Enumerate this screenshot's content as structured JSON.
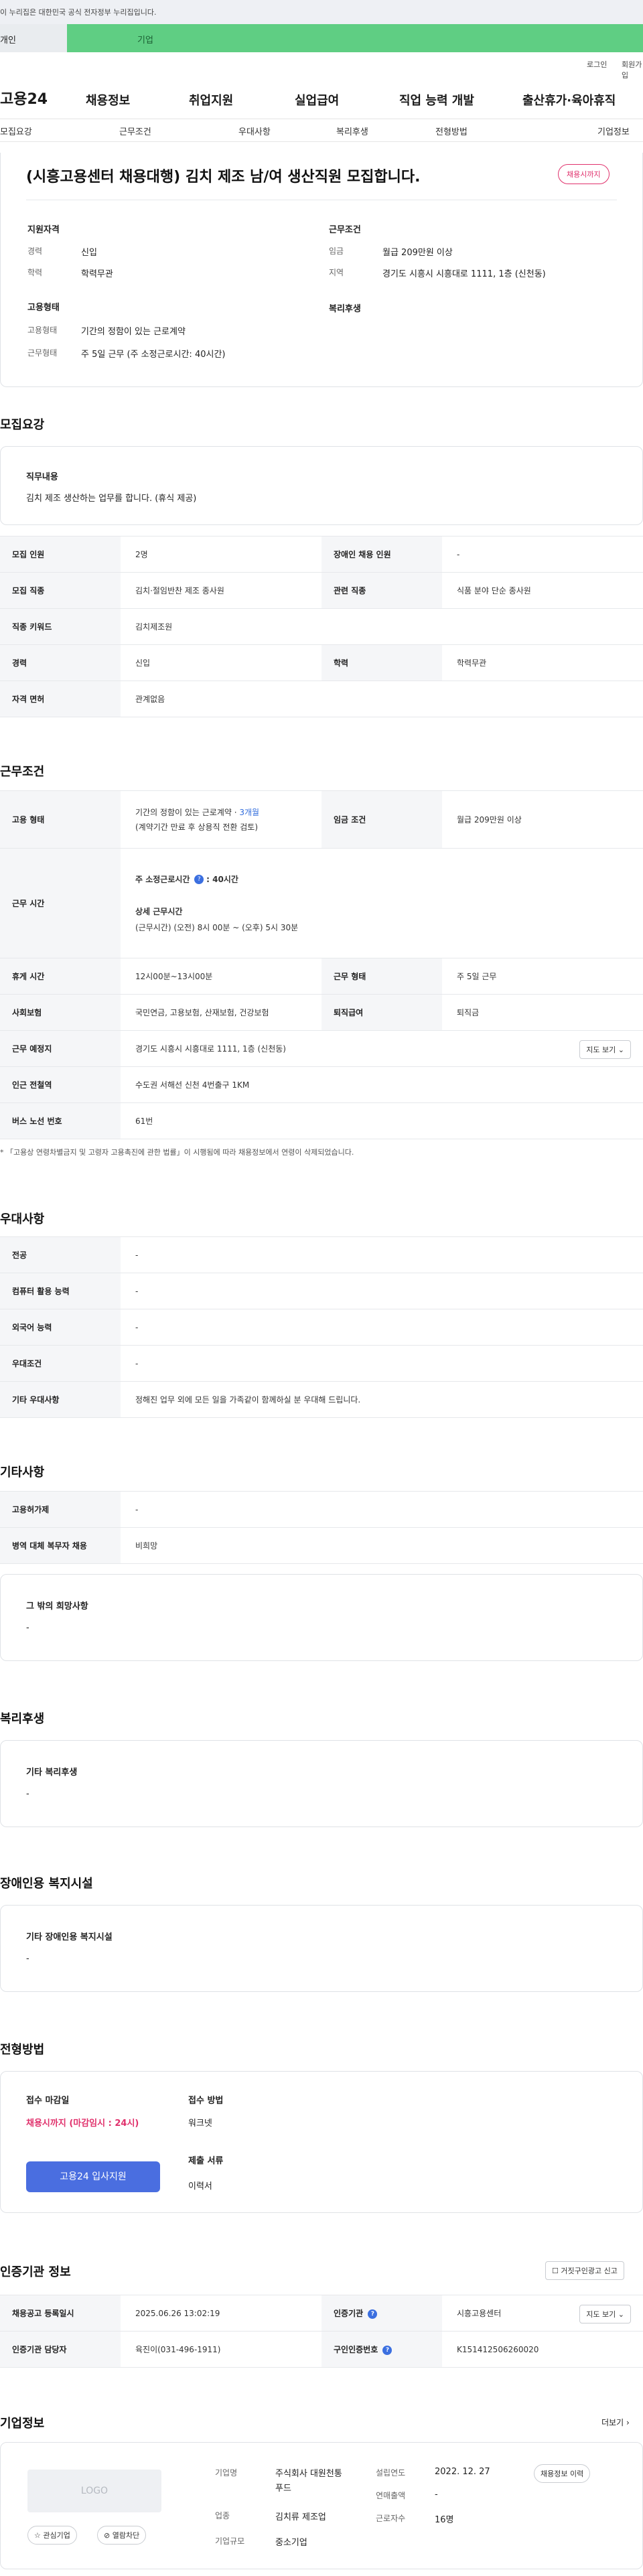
{
  "gov_banner": "이 누리집은 대한민국 공식 전자정부 누리집입니다.",
  "user_tabs": {
    "person": "개인",
    "corp": "기업"
  },
  "util": {
    "login": "로그인",
    "join": "회원가입"
  },
  "gnb": {
    "logo": "고용24",
    "menu": [
      "채용정보",
      "취업지원",
      "실업급여",
      "직업 능력 개발",
      "출산휴가·육아휴직"
    ]
  },
  "lnb": [
    "모집요강",
    "근무조건",
    "우대사항",
    "복리후생",
    "전형방법",
    "기업정보"
  ],
  "job": {
    "title": "(시흥고용센터 채용대행) 김치 제조 남/여 생산직원 모집합니다.",
    "status_badge": "채용시까지",
    "qual_title": "지원자격",
    "career_label": "경력",
    "career": "신입",
    "edu_label": "학력",
    "edu": "학력무관",
    "emp_title": "고용형태",
    "emp_type_label": "고용형태",
    "emp_type": "기간의 정함이 있는 근로계약",
    "work_form_label": "근무형태",
    "work_form": "주 5일 근무 (주 소정근로시간: 40시간)",
    "cond_title": "근무조건",
    "wage_label": "임금",
    "wage": "월급 209만원 이상",
    "region_label": "지역",
    "region": "경기도 시흥시 시흥대로 1111, 1층 (신천동)",
    "welfare_title": "복리후생"
  },
  "recruit": {
    "section_title": "모집요강",
    "duty_title": "직무내용",
    "duty_text": "김치 제조 생산하는 업무를 합니다. (휴식 제공)",
    "rows": [
      {
        "h1": "모집 인원",
        "v1": "2명",
        "h2": "장애인 채용 인원",
        "v2": "-"
      },
      {
        "h1": "모집 직종",
        "v1": "김치·절임반찬 제조 종사원",
        "h2": "관련 직종",
        "v2": "식품 분야 단순 종사원"
      },
      {
        "h1": "직종 키워드",
        "v1": "김치제조원"
      },
      {
        "h1": "경력",
        "v1": "신입",
        "h2": "학력",
        "v2": "학력무관"
      },
      {
        "h1": "자격 면허",
        "v1": "관계없음"
      }
    ]
  },
  "conditions": {
    "section_title": "근무조건",
    "emp_h": "고용 형태",
    "emp_v": "기간의 정함이 있는 근로계약 · ",
    "emp_period": "3개월",
    "emp_note": "(계약기간 만료 후 상용직 전환 검토)",
    "wage_h": "임금 조건",
    "wage_v": "월급 209만원 이상",
    "hours_h": "근무 시간",
    "hours_std": "주 소정근로시간",
    "hours_std_val": ": 40시간",
    "hours_detail_title": "상세 근무시간",
    "hours_detail": "(근무시간) (오전) 8시 00분 ~ (오후) 5시 30분",
    "break_h": "휴게 시간",
    "break_v": "12시00분~13시00분",
    "form_h": "근무 형태",
    "form_v": "주 5일 근무",
    "ins_h": "사회보험",
    "ins_v": "국민연금, 고용보험, 산재보험, 건강보험",
    "sev_h": "퇴직급여",
    "sev_v": "퇴직금",
    "place_h": "근무 예정지",
    "place_v": "경기도 시흥시 시흥대로 1111, 1층 (신천동)",
    "map_btn": "지도 보기",
    "subway_h": "인근 전철역",
    "subway_v": "수도권 서해선 신천 4번출구 1KM",
    "bus_h": "버스 노선 번호",
    "bus_v": "61번",
    "notice": "「고용상 연령차별금지 및 고령자 고용촉진에 관한 법률」이 시행됨에 따라 채용정보에서 연령이 삭제되었습니다."
  },
  "preference": {
    "section_title": "우대사항",
    "rows": [
      {
        "h": "전공",
        "v": "-"
      },
      {
        "h": "컴퓨터 활용 능력",
        "v": "-"
      },
      {
        "h": "외국어 능력",
        "v": "-"
      },
      {
        "h": "우대조건",
        "v": "-"
      },
      {
        "h": "기타 우대사항",
        "v": "정해진 업무 외에 모든 일을 가족같이 함께하실 분 우대해 드립니다."
      }
    ]
  },
  "etc": {
    "section_title": "기타사항",
    "rows": [
      {
        "h": "고용허가제",
        "v": "-"
      },
      {
        "h": "병역 대체 복무자 채용",
        "v": "비희망"
      }
    ],
    "other_title": "그 밖의 희망사항",
    "other_val": "-"
  },
  "welfare": {
    "section_title": "복리후생",
    "box_title": "기타 복리후생",
    "box_val": "-"
  },
  "disabled": {
    "section_title": "장애인용 복지시설",
    "box_title": "기타 장애인용 복지시설",
    "box_val": "-"
  },
  "selection": {
    "section_title": "전형방법",
    "deadline_label": "접수 마감일",
    "deadline_val": "채용시까지 (마감임시 : 24시)",
    "apply_btn": "고용24 입사지원",
    "method_label": "접수 방법",
    "method_val": "워크넷",
    "docs_label": "제출 서류",
    "docs_val": "이력서"
  },
  "agency": {
    "section_title": "인증기관 정보",
    "report_btn": "거짓구인광고 신고",
    "rows": [
      {
        "h1": "채용공고 등록일시",
        "v1": "2025.06.26 13:02:19",
        "h2": "인증기관",
        "v2": "시흥고용센터",
        "btn": "지도 보기"
      },
      {
        "h1": "인증기관 담당자",
        "v1": "육진이(031-496-1911)",
        "h2": "구인인증번호",
        "v2": "K151412506260020"
      }
    ]
  },
  "company": {
    "section_title": "기업정보",
    "more": "더보기",
    "logo": "LOGO",
    "fav_btn": "관심기업",
    "block_btn": "열람차단",
    "name_label": "기업명",
    "name": "주식회사 대원천통푸드",
    "industry_label": "업종",
    "industry": "김치류 제조업",
    "size_label": "기업규모",
    "size": "중소기업",
    "founded_label": "설립연도",
    "founded": "2022. 12. 27",
    "revenue_label": "연매출액",
    "revenue": "-",
    "staff_label": "근로자수",
    "staff": "16명",
    "history_btn": "채용정보 이력"
  }
}
